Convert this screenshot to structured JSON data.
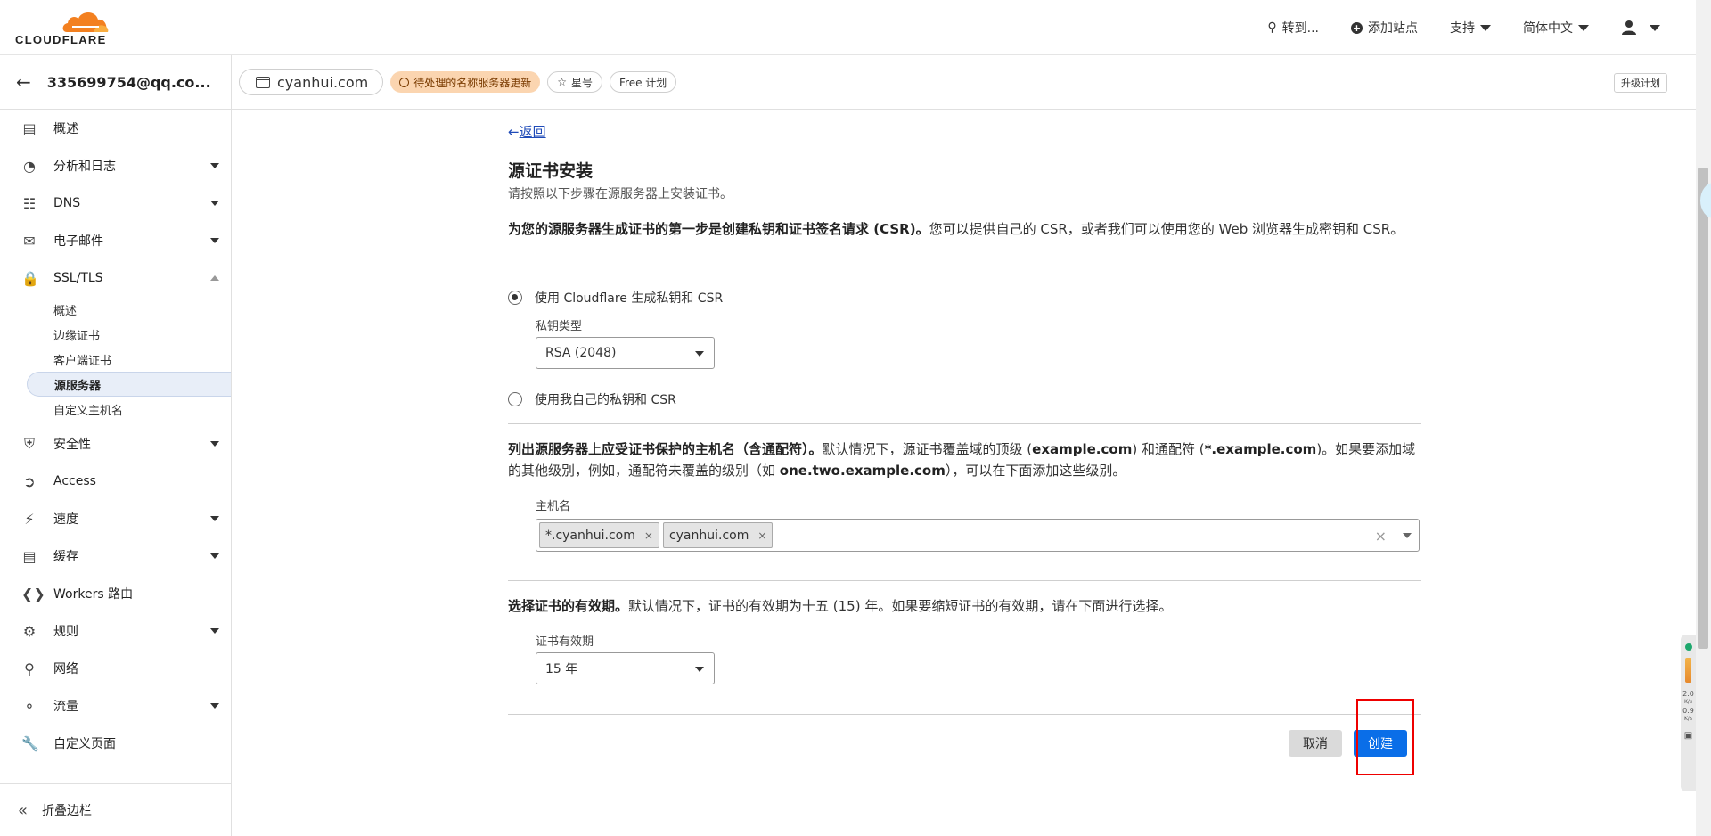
{
  "header": {
    "logo_text": "CLOUDFLARE",
    "goto_label": "转到...",
    "add_site_label": "添加站点",
    "support_label": "支持",
    "language_label": "简体中文"
  },
  "account": {
    "email": "335699754@qq.co..."
  },
  "zone": {
    "domain": "cyanhui.com",
    "pending_badge": "待处理的名称服务器更新",
    "star_badge": "星号",
    "plan_badge": "Free 计划",
    "upgrade_label": "升级计划"
  },
  "sidebar": {
    "items": [
      {
        "label": "概述",
        "icon": "document-icon"
      },
      {
        "label": "分析和日志",
        "icon": "chart-pie-icon"
      },
      {
        "label": "DNS",
        "icon": "network-tree-icon"
      },
      {
        "label": "电子邮件",
        "icon": "mail-icon"
      },
      {
        "label": "SSL/TLS",
        "icon": "lock-icon"
      },
      {
        "label": "安全性",
        "icon": "shield-icon"
      },
      {
        "label": "Access",
        "icon": "access-icon"
      },
      {
        "label": "速度",
        "icon": "lightning-icon"
      },
      {
        "label": "缓存",
        "icon": "server-icon"
      },
      {
        "label": "Workers 路由",
        "icon": "workers-icon"
      },
      {
        "label": "规则",
        "icon": "rules-icon"
      },
      {
        "label": "网络",
        "icon": "location-pin-icon"
      },
      {
        "label": "流量",
        "icon": "traffic-icon"
      },
      {
        "label": "自定义页面",
        "icon": "wrench-icon"
      }
    ],
    "ssl_sub": [
      "概述",
      "边缘证书",
      "客户端证书",
      "源服务器",
      "自定义主机名"
    ],
    "collapse_label": "折叠边栏"
  },
  "main": {
    "back_label": "返回",
    "title": "源证书安装",
    "subtitle": "请按照以下步骤在源服务器上安装证书。",
    "step1_bold": "为您的源服务器生成证书的第一步是创建私钥和证书签名请求 (CSR)。",
    "step1_text": "您可以提供自己的 CSR，或者我们可以使用您的 Web 浏览器生成密钥和 CSR。",
    "radio_cloudflare": "使用 Cloudflare 生成私钥和 CSR",
    "private_key_label": "私钥类型",
    "private_key_value": "RSA (2048)",
    "radio_own": "使用我自己的私钥和 CSR",
    "hosts_bold": "列出源服务器上应受证书保护的主机名（含通配符）。",
    "hosts_text_1": "默认情况下，源证书覆盖域的顶级 (",
    "hosts_example": "example.com",
    "hosts_text_2": ") 和通配符 (",
    "hosts_wildcard": "*.example.com",
    "hosts_text_3": ")。如果要添加域的其他级别，例如，通配符未覆盖的级别（如 ",
    "hosts_level": "one.two.example.com",
    "hosts_text_4": "），可以在下面添加这些级别。",
    "hostname_label": "主机名",
    "hostnames": [
      "*.cyanhui.com",
      "cyanhui.com"
    ],
    "validity_bold": "选择证书的有效期。",
    "validity_text": "默认情况下，证书的有效期为十五 (15) 年。如果要缩短证书的有效期，请在下面进行选择。",
    "validity_label": "证书有效期",
    "validity_value": "15 年",
    "cancel_label": "取消",
    "create_label": "创建"
  },
  "widget": {
    "upload": "2.0",
    "download": "0.9",
    "unit": "K/s"
  }
}
